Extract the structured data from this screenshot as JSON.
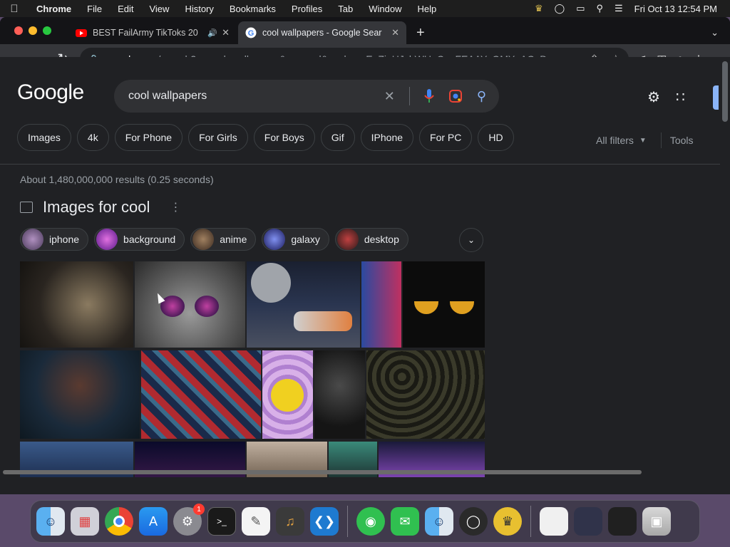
{
  "menubar": {
    "app": "Chrome",
    "items": [
      "File",
      "Edit",
      "View",
      "History",
      "Bookmarks",
      "Profiles",
      "Tab",
      "Window",
      "Help"
    ],
    "clock": "Fri Oct 13  12:54 PM"
  },
  "tabs": [
    {
      "title": "BEST FailArmy TikToks 20",
      "active": false
    },
    {
      "title": "cool wallpapers - Google Sear",
      "active": true
    }
  ],
  "address": {
    "host": "google.com",
    "path": "/search?q=cool+wallpapers&oq=cool&gs_lcrp=EgZjaHJvbWUqCggFEAAYsQMYgAQyDw..."
  },
  "search": {
    "logo": "Google",
    "query": "cool wallpapers"
  },
  "filter_chips": [
    "Images",
    "4k",
    "For Phone",
    "For Girls",
    "For Boys",
    "Gif",
    "IPhone",
    "For PC",
    "HD"
  ],
  "filters": {
    "all_filters": "All filters",
    "tools": "Tools"
  },
  "stats": "About 1,480,000,000 results (0.25 seconds)",
  "images_section": {
    "title": "Images for cool",
    "chips": [
      {
        "label": "iphone",
        "color": "#7a5a8a"
      },
      {
        "label": "background",
        "color": "#b03ab0"
      },
      {
        "label": "anime",
        "color": "#6b5040"
      },
      {
        "label": "galaxy",
        "color": "#3a4aa0"
      },
      {
        "label": "desktop",
        "color": "#8a2a2a"
      }
    ]
  },
  "dock": {
    "badge": "1"
  }
}
